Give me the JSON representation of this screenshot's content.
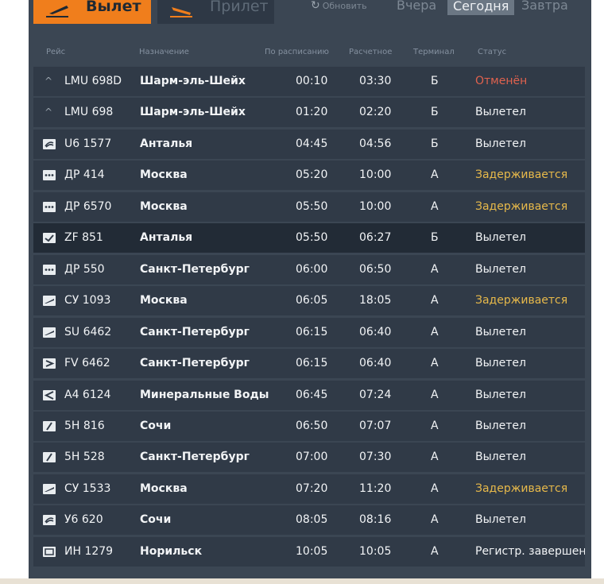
{
  "tabs": {
    "departure": "Вылет",
    "arrival": "Прилет"
  },
  "refresh_label": "Обновить",
  "days": {
    "yesterday": "Вчера",
    "today": "Сегодня",
    "tomorrow": "Завтра"
  },
  "columns": {
    "flight": "Рейс",
    "destination": "Назначение",
    "scheduled": "По расписанию",
    "estimated": "Расчетное",
    "terminal": "Терминал",
    "status": "Статус"
  },
  "flights": [
    {
      "logo": "caret-icon",
      "flight": "LMU 698D",
      "destination": "Шарм-эль-Шейх",
      "scheduled": "00:10",
      "estimated": "03:30",
      "terminal": "Б",
      "status": "Отменён",
      "status_type": "cancelled"
    },
    {
      "logo": "caret-icon",
      "flight": "LMU 698",
      "destination": "Шарм-эль-Шейх",
      "scheduled": "01:20",
      "estimated": "02:20",
      "terminal": "Б",
      "status": "Вылетел",
      "status_type": "departed"
    },
    {
      "logo": "airline-swirl-icon",
      "flight": "U6 1577",
      "destination": "Анталья",
      "scheduled": "04:45",
      "estimated": "04:56",
      "terminal": "Б",
      "status": "Вылетел",
      "status_type": "departed"
    },
    {
      "logo": "airline-dots-icon",
      "flight": "ДР 414",
      "destination": "Москва",
      "scheduled": "05:20",
      "estimated": "10:00",
      "terminal": "А",
      "status": "Задерживается",
      "status_type": "delayed"
    },
    {
      "logo": "airline-dots-icon",
      "flight": "ДР 6570",
      "destination": "Москва",
      "scheduled": "05:50",
      "estimated": "10:00",
      "terminal": "А",
      "status": "Задерживается",
      "status_type": "delayed"
    },
    {
      "logo": "airline-check-icon",
      "flight": "ZF 851",
      "destination": "Анталья",
      "scheduled": "05:50",
      "estimated": "06:27",
      "terminal": "Б",
      "status": "Вылетел",
      "status_type": "departed",
      "dark": true
    },
    {
      "logo": "airline-dots-icon",
      "flight": "ДР 550",
      "destination": "Санкт-Петербург",
      "scheduled": "06:00",
      "estimated": "06:50",
      "terminal": "А",
      "status": "Вылетел",
      "status_type": "departed"
    },
    {
      "logo": "airline-wing-icon",
      "flight": "СУ 1093",
      "destination": "Москва",
      "scheduled": "06:05",
      "estimated": "18:05",
      "terminal": "А",
      "status": "Задерживается",
      "status_type": "delayed"
    },
    {
      "logo": "airline-wing-icon",
      "flight": "SU 6462",
      "destination": "Санкт-Петербург",
      "scheduled": "06:15",
      "estimated": "06:40",
      "terminal": "А",
      "status": "Вылетел",
      "status_type": "departed"
    },
    {
      "logo": "airline-r-icon",
      "flight": "FV 6462",
      "destination": "Санкт-Петербург",
      "scheduled": "06:15",
      "estimated": "06:40",
      "terminal": "А",
      "status": "Вылетел",
      "status_type": "departed"
    },
    {
      "logo": "airline-arrow-icon",
      "flight": "A4 6124",
      "destination": "Минеральные Воды",
      "scheduled": "06:45",
      "estimated": "07:24",
      "terminal": "А",
      "status": "Вылетел",
      "status_type": "departed"
    },
    {
      "logo": "airline-slash-icon",
      "flight": "5H 816",
      "destination": "Сочи",
      "scheduled": "06:50",
      "estimated": "07:07",
      "terminal": "А",
      "status": "Вылетел",
      "status_type": "departed"
    },
    {
      "logo": "airline-slash-icon",
      "flight": "5H 528",
      "destination": "Санкт-Петербург",
      "scheduled": "07:00",
      "estimated": "07:30",
      "terminal": "А",
      "status": "Вылетел",
      "status_type": "departed"
    },
    {
      "logo": "airline-wing-icon",
      "flight": "СУ 1533",
      "destination": "Москва",
      "scheduled": "07:20",
      "estimated": "11:20",
      "terminal": "А",
      "status": "Задерживается",
      "status_type": "delayed"
    },
    {
      "logo": "airline-swirl-icon",
      "flight": "У6 620",
      "destination": "Сочи",
      "scheduled": "08:05",
      "estimated": "08:16",
      "terminal": "А",
      "status": "Вылетел",
      "status_type": "departed"
    },
    {
      "logo": "airline-box-icon",
      "flight": "ИН 1279",
      "destination": "Норильск",
      "scheduled": "10:05",
      "estimated": "10:05",
      "terminal": "А",
      "status": "Регистр. завершен",
      "status_type": "departed"
    }
  ],
  "colors": {
    "board_bg": "#3b4653",
    "row_bg": "#303a47",
    "row_dark_bg": "#222b36",
    "accent": "#f07e1c",
    "cancelled": "#e0624e",
    "delayed": "#e7b94a"
  }
}
